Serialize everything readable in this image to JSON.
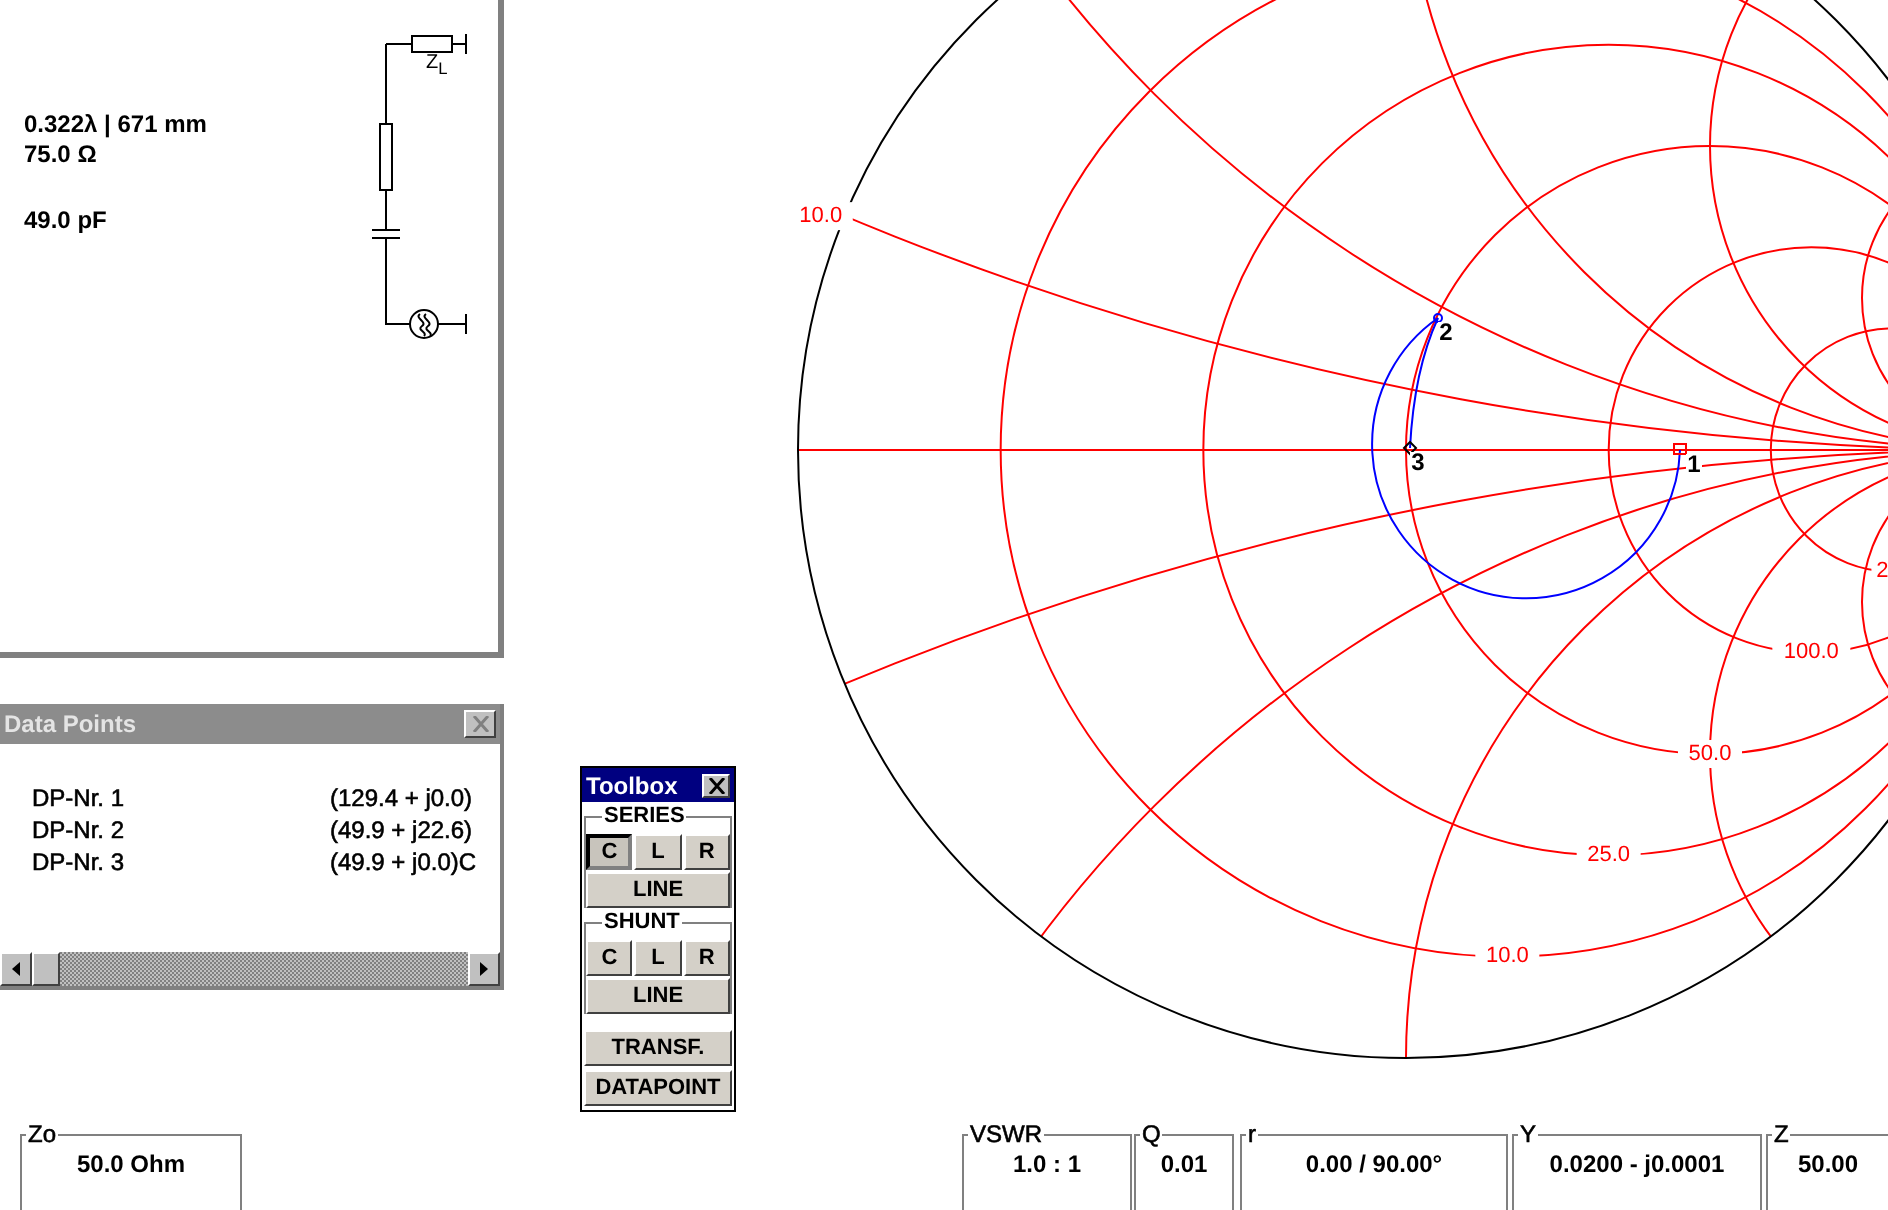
{
  "line_panel": {
    "length": "0.322λ | 671 mm",
    "impedance": "75.0  Ω",
    "capacitance": "49.0 pF",
    "load_label": "Z$_{L}$"
  },
  "data_points": {
    "title": "Data Points",
    "active": false,
    "rows": [
      {
        "name": "DP-Nr. 1",
        "value": "(129.4 + j0.0)"
      },
      {
        "name": "DP-Nr. 2",
        "value": "(49.9 + j22.6)"
      },
      {
        "name": "DP-Nr. 3",
        "value": "(49.9 + j0.0)C"
      }
    ]
  },
  "toolbox": {
    "title": "Toolbox",
    "active": true,
    "groups": [
      {
        "label": "SERIES",
        "buttons": [
          {
            "label": "C",
            "selected": true
          },
          {
            "label": "L",
            "selected": false
          },
          {
            "label": "R",
            "selected": false
          }
        ],
        "line": "LINE"
      },
      {
        "label": "SHUNT",
        "buttons": [
          {
            "label": "C",
            "selected": false
          },
          {
            "label": "L",
            "selected": false
          },
          {
            "label": "R",
            "selected": false
          }
        ],
        "line": "LINE"
      }
    ],
    "buttons": [
      "TRANSF.",
      "DATAPOINT"
    ]
  },
  "smith_chart": {
    "resistance_labels": [
      "10.0",
      "25.0",
      "50.0",
      "100.0",
      "2"
    ],
    "reactance_label": "10.0",
    "point_labels": [
      "1",
      "2",
      "3"
    ]
  },
  "status": [
    {
      "label": "Zo",
      "value": "50.0 Ohm"
    },
    {
      "label": "VSWR",
      "value": "1.0 : 1"
    },
    {
      "label": "Q",
      "value": "0.01"
    },
    {
      "label": "r",
      "value": "0.00 / 90.00°"
    },
    {
      "label": "Y",
      "value": "0.0200 - j0.0001"
    },
    {
      "label": "Z",
      "value": "50.00"
    }
  ]
}
